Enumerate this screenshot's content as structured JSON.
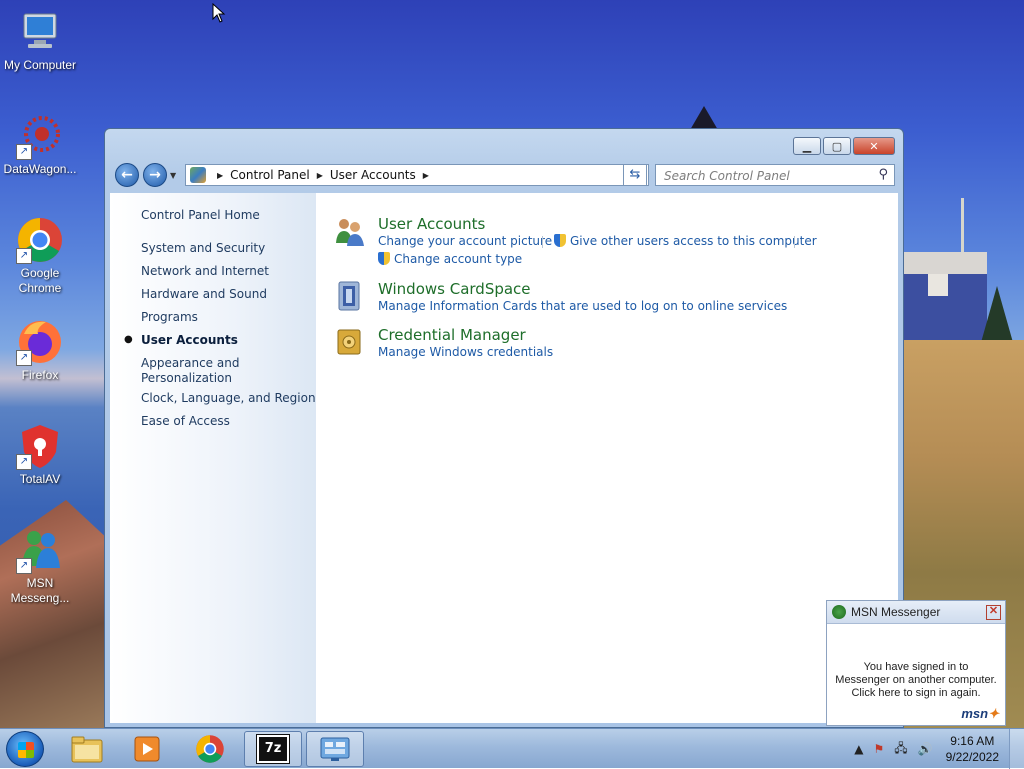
{
  "desktop": {
    "icons": [
      {
        "label": "My Computer",
        "icon": "computer-icon"
      },
      {
        "label": "DataWagon...",
        "icon": "datawagon-icon"
      },
      {
        "label": "Google Chrome",
        "icon": "chrome-icon"
      },
      {
        "label": "Firefox",
        "icon": "firefox-icon"
      },
      {
        "label": "TotalAV",
        "icon": "totalav-icon"
      },
      {
        "label": "MSN Messeng...",
        "icon": "msn-messenger-icon"
      }
    ]
  },
  "window": {
    "buttons": {
      "minimize": "▁",
      "maximize": "▢",
      "close": "✕"
    },
    "nav": {
      "back": "←",
      "forward": "→"
    },
    "breadcrumb": [
      "Control Panel",
      "User Accounts"
    ],
    "search_placeholder": "Search Control Panel",
    "sidebar": {
      "items": [
        "Control Panel Home",
        "System and Security",
        "Network and Internet",
        "Hardware and Sound",
        "Programs",
        "User Accounts",
        "Appearance and Personalization",
        "Clock, Language, and Region",
        "Ease of Access"
      ],
      "active_index": 5
    },
    "categories": [
      {
        "title": "User Accounts",
        "icon": "user-accounts-icon",
        "links": [
          "Change your account picture",
          "Give other users access to this computer",
          "Change account type"
        ]
      },
      {
        "title": "Windows CardSpace",
        "icon": "cardspace-icon",
        "links": [
          "Manage Information Cards that are used to log on to online services"
        ]
      },
      {
        "title": "Credential Manager",
        "icon": "credential-manager-icon",
        "links": [
          "Manage Windows credentials"
        ]
      }
    ]
  },
  "msn_popup": {
    "title": "MSN Messenger",
    "message": "You have signed in to Messenger on another computer. Click here to sign in again.",
    "logo": "msn"
  },
  "taskbar": {
    "pinned": [
      "explorer-icon",
      "media-player-icon",
      "chrome-icon",
      "7zip-icon",
      "control-panel-icon"
    ],
    "seven_zip_label": "7z",
    "time": "9:16 AM",
    "date": "9/22/2022"
  },
  "colors": {
    "link": "#1e5aa6",
    "category_title": "#1e6e2a",
    "taskbar": "#9db9dc"
  }
}
